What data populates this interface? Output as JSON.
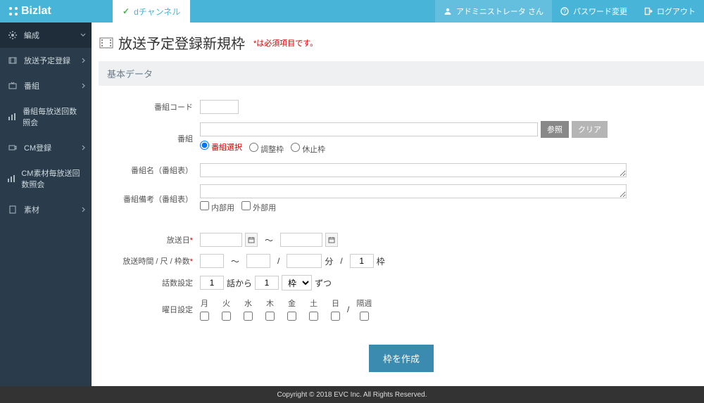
{
  "brand": "Bizlat",
  "tab_label": "dチャンネル",
  "topbar": {
    "admin": "アドミニストレータ さん",
    "password": "パスワード変更",
    "logout": "ログアウト"
  },
  "sidebar": {
    "items": [
      {
        "label": "編成",
        "chev": "v"
      },
      {
        "label": "放送予定登録",
        "chev": ">"
      },
      {
        "label": "番組",
        "chev": ">"
      },
      {
        "label": "番組毎放送回数照会"
      },
      {
        "label": "CM登録",
        "chev": ">"
      },
      {
        "label": "CM素材毎放送回数照会"
      },
      {
        "label": "素材",
        "chev": ">"
      }
    ]
  },
  "page": {
    "title": "放送予定登録新規枠",
    "required_note": "*は必須項目です。"
  },
  "panel": {
    "title": "基本データ"
  },
  "form": {
    "labels": {
      "code": "番組コード",
      "program": "番組",
      "program_name": "番組名（番組表）",
      "program_note": "番組備考（番組表）",
      "broadcast_date": "放送日",
      "time_scale_slots": "放送時間 / 尺 / 枠数",
      "episode_setting": "話数設定",
      "day_setting": "曜日設定"
    },
    "buttons": {
      "browse": "参照",
      "clear": "クリア",
      "submit": "枠を作成"
    },
    "radios": {
      "program_select": "番組選択",
      "adjust_slot": "調整枠",
      "stop_slot": "休止枠"
    },
    "checks": {
      "internal": "内部用",
      "external": "外部用"
    },
    "text": {
      "tilde": "〜",
      "slash": "/",
      "minutes": "分",
      "slots": "枠",
      "ep_from": "話から",
      "each": "ずつ",
      "alt_week": "隔週"
    },
    "values": {
      "slot_count": "1",
      "ep_start": "1",
      "ep_step": "1"
    },
    "ep_unit_options": [
      "枠"
    ],
    "days": [
      "月",
      "火",
      "水",
      "木",
      "金",
      "土",
      "日"
    ]
  },
  "footer": "Copyright © 2018 EVC Inc. All Rights Reserved."
}
